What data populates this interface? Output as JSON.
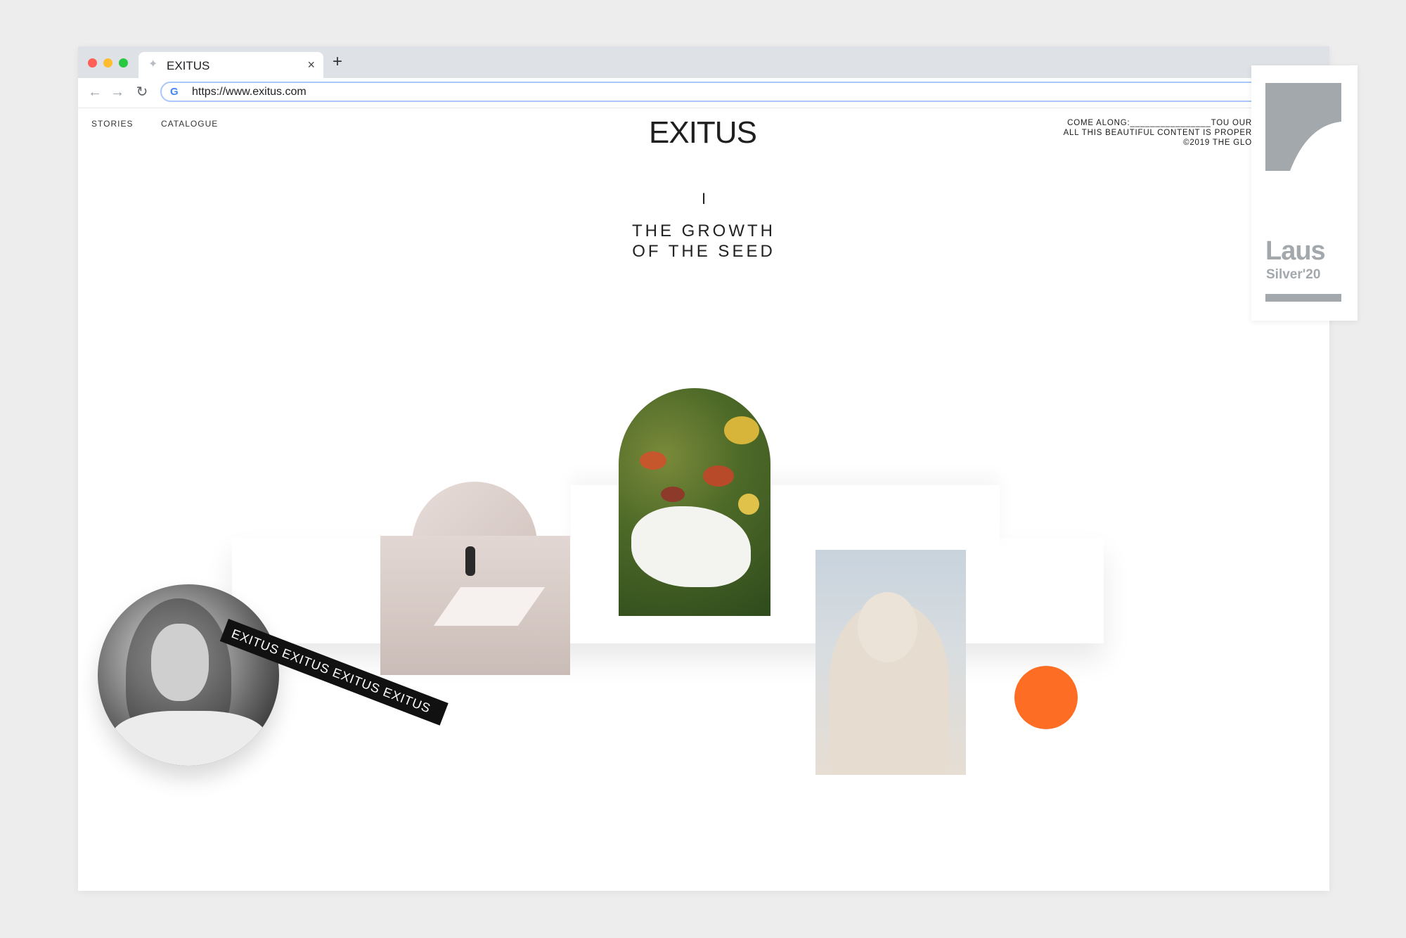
{
  "browser": {
    "tab_title": "EXITUS",
    "tab_close": "×",
    "new_tab": "+",
    "url": "https://www.exitus.com",
    "back": "←",
    "forward": "→",
    "reload": "↻",
    "favicon": "G"
  },
  "site": {
    "nav": [
      "STORIES",
      "CATALOGUE"
    ],
    "logo": "EXITUS",
    "notice_lines": [
      "COME ALONG:________________TOU OUR",
      "ALL THIS BEAUTIFUL CONTENT IS PROPER",
      "©2019 THE GLO"
    ],
    "chapter_numeral": "I",
    "chapter_title_lines": [
      "THE GROWTH",
      "OF THE SEED"
    ],
    "ticker_text": "EXITUS EXITUS EXITUS EXITUS",
    "accent_color": "#fd6d24"
  },
  "award": {
    "title": "Laus",
    "subtitle": "Silver'20",
    "color": "#a3a8ac"
  }
}
